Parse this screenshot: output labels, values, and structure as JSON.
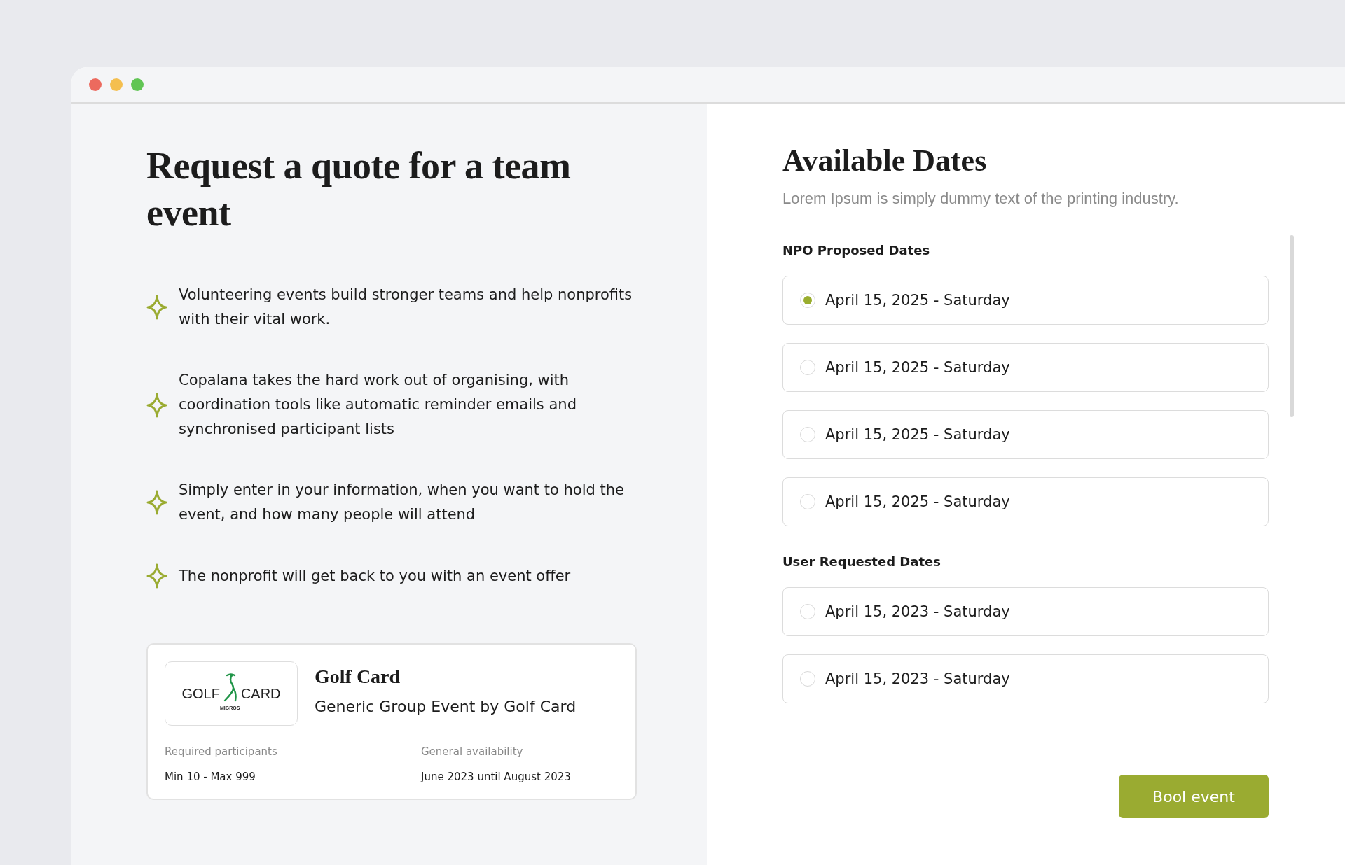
{
  "window": {
    "controls": [
      {
        "color": "#ec6a5e"
      },
      {
        "color": "#f4bf4f"
      },
      {
        "color": "#61c554"
      }
    ]
  },
  "intro": {
    "title": "Request a quote for a team event",
    "points": [
      "Volunteering events build stronger teams and help nonprofits with their vital work.",
      "Copalana takes the hard work out of organising, with coordination tools like automatic reminder emails and synchronised participant lists",
      "Simply enter in your information, when you want to hold the event, and how many people will attend",
      "The nonprofit will get back to you with an event offer"
    ]
  },
  "offer": {
    "logo": {
      "left": "GOLF",
      "right": "CARD",
      "sub": "MIGROS"
    },
    "name": "Golf Card",
    "description": "Generic Group Event by Golf Card",
    "details": [
      {
        "label": "Required participants",
        "value": "Min 10 - Max 999"
      },
      {
        "label": "General availability",
        "value": "June 2023 until August 2023"
      }
    ]
  },
  "dates": {
    "title": "Available Dates",
    "subtitle": "Lorem Ipsum is simply dummy text of the printing industry.",
    "groups": [
      {
        "heading": "NPO Proposed Dates",
        "options": [
          {
            "label": "April 15, 2025 - Saturday",
            "selected": true
          },
          {
            "label": "April 15, 2025 - Saturday",
            "selected": false
          },
          {
            "label": "April 15, 2025 - Saturday",
            "selected": false
          },
          {
            "label": "April 15, 2025 - Saturday",
            "selected": false
          }
        ]
      },
      {
        "heading": "User Requested Dates",
        "options": [
          {
            "label": "April 15, 2023 - Saturday",
            "selected": false
          },
          {
            "label": "April 15, 2023 - Saturday",
            "selected": false
          }
        ]
      }
    ],
    "button": "Bool event"
  }
}
